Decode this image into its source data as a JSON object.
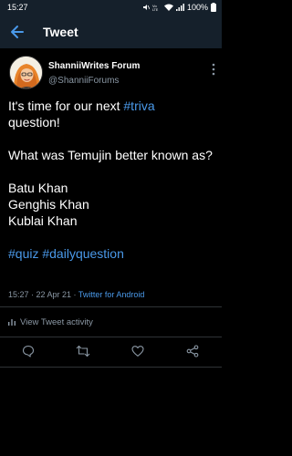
{
  "status_bar": {
    "time": "15:27",
    "battery": "100%"
  },
  "header": {
    "title": "Tweet"
  },
  "tweet": {
    "author_name": "ShanniiWrites Forum",
    "author_handle": "@ShanniiForums",
    "text": {
      "line1_prefix": "It's time for our next ",
      "line1_hashtag": "#triva",
      "line1_suffix": "question!",
      "question": "What was Temujin better known as?",
      "options": [
        "Batu Khan",
        "Genghis Khan",
        "Kublai Khan"
      ],
      "hashtags": "#quiz #dailyquestion"
    },
    "timestamp": "15:27 · 22 Apr 21 · ",
    "client": "Twitter for Android"
  },
  "activity": {
    "label": "View Tweet activity"
  },
  "icons": {
    "back": "arrow-left-icon",
    "more": "more-vertical-icon",
    "reply": "comment-icon",
    "retweet": "retweet-icon",
    "like": "heart-icon",
    "share": "share-icon",
    "activity": "bar-chart-icon"
  },
  "colors": {
    "accent": "#4a99e9",
    "background": "#000000",
    "header_bg": "#15202b",
    "secondary_text": "#8b98a5"
  }
}
